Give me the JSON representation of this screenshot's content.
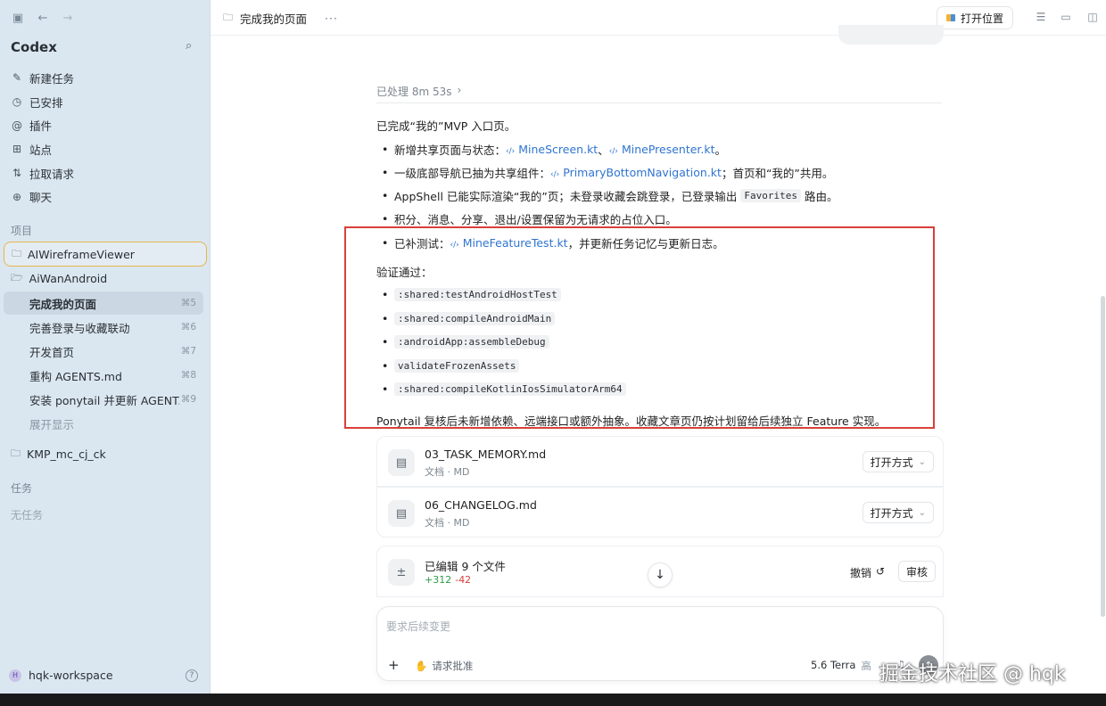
{
  "app": {
    "name": "Codex"
  },
  "sidebar": {
    "nav": [
      {
        "label": "新建任务",
        "icon": "edit-icon"
      },
      {
        "label": "已安排",
        "icon": "clock-icon"
      },
      {
        "label": "插件",
        "icon": "plugin-icon"
      },
      {
        "label": "站点",
        "icon": "sites-icon"
      },
      {
        "label": "拉取请求",
        "icon": "pull-request-icon"
      },
      {
        "label": "聊天",
        "icon": "chat-icon"
      }
    ],
    "projects_label": "项目",
    "projects": [
      {
        "name": "AIWireframeViewer"
      },
      {
        "name": "AiWanAndroid"
      },
      {
        "name": "KMP_mc_cj_ck"
      }
    ],
    "threads": [
      {
        "title": "完成我的页面",
        "shortcut": "⌘5"
      },
      {
        "title": "完善登录与收藏联动",
        "shortcut": "⌘6"
      },
      {
        "title": "开发首页",
        "shortcut": "⌘7"
      },
      {
        "title": "重构 AGENTS.md",
        "shortcut": "⌘8"
      },
      {
        "title": "安装 ponytail 并更新 AGENT.n",
        "shortcut": "⌘9"
      }
    ],
    "expand_label": "展开显示",
    "tasks_label": "任务",
    "no_tasks": "无任务",
    "workspace": {
      "avatar": "H",
      "name": "hqk-workspace"
    }
  },
  "topbar": {
    "title": "完成我的页面",
    "more": "···",
    "open_location": "打开位置"
  },
  "conversation": {
    "processed": "已处理 8m 53s",
    "summary_intro": "已完成“我的”MVP 入口页。",
    "bullets": {
      "b1_text": "新增共享页面与状态：",
      "b1_link1": "MineScreen.kt",
      "b1_sep": "、",
      "b1_link2": "MinePresenter.kt",
      "b1_end": "。",
      "b2_text": "一级底部导航已抽为共享组件：",
      "b2_link": "PrimaryBottomNavigation.kt",
      "b2_end": "；首页和“我的”共用。",
      "b3_text": "AppShell 已能实际渲染“我的”页；未登录收藏会跳登录，已登录输出",
      "b3_code": "Favorites",
      "b3_end": "路由。",
      "b4_text": "积分、消息、分享、退出/设置保留为无请求的占位入口。",
      "b5_text": "已补测试：",
      "b5_link": "MineFeatureTest.kt",
      "b5_end": "，并更新任务记忆与更新日志。"
    },
    "verify_label": "验证通过：",
    "verify_items": [
      ":shared:testAndroidHostTest",
      ":shared:compileAndroidMain",
      ":androidApp:assembleDebug",
      "validateFrozenAssets",
      ":shared:compileKotlinIosSimulatorArm64"
    ],
    "closing": "Ponytail 复核后未新增依赖、远端接口或额外抽象。收藏文章页仍按计划留给后续独立 Feature 实现。"
  },
  "files": [
    {
      "name": "03_TASK_MEMORY.md",
      "meta": "文档 · MD",
      "action": "打开方式"
    },
    {
      "name": "06_CHANGELOG.md",
      "meta": "文档 · MD",
      "action": "打开方式"
    }
  ],
  "edits": {
    "title": "已编辑 9 个文件",
    "added": "+312",
    "removed": "-42",
    "undo": "撤销",
    "review": "审核"
  },
  "composer": {
    "placeholder": "要求后续变更",
    "approval": "请求批准",
    "model": "5.6 Terra",
    "level": "高"
  },
  "watermark": "掘金技术社区 @ hqk",
  "colors": {
    "accent_link": "#2f74d0",
    "highlight_box": "#d9403a",
    "focus_ring": "#e6b54a",
    "added": "#2f9a47",
    "removed": "#d9403a"
  }
}
